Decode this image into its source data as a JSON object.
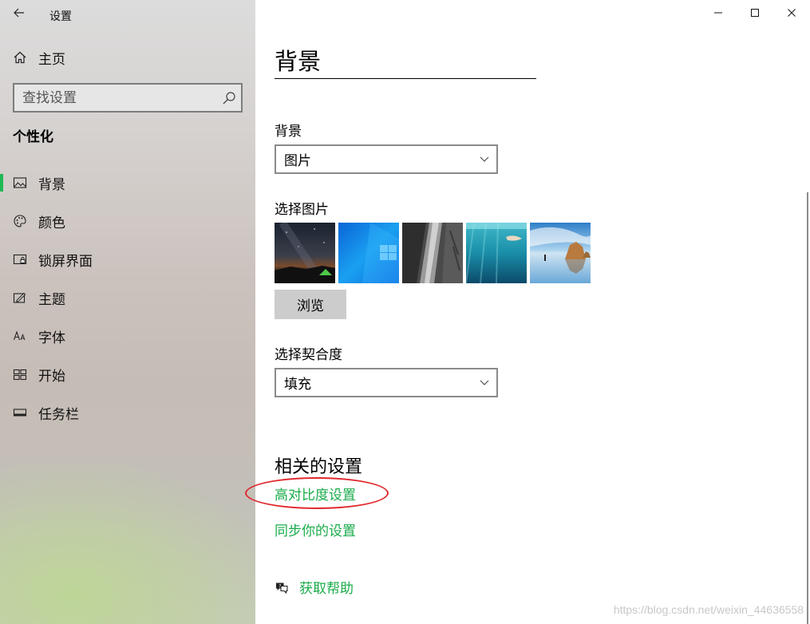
{
  "app": {
    "title": "设置"
  },
  "sidebar": {
    "home_label": "主页",
    "search_placeholder": "查找设置",
    "section_title": "个性化",
    "items": [
      {
        "label": "背景",
        "icon": "picture-icon",
        "active": true
      },
      {
        "label": "颜色",
        "icon": "palette-icon",
        "active": false
      },
      {
        "label": "锁屏界面",
        "icon": "lock-screen-icon",
        "active": false
      },
      {
        "label": "主题",
        "icon": "theme-icon",
        "active": false
      },
      {
        "label": "字体",
        "icon": "font-icon",
        "active": false
      },
      {
        "label": "开始",
        "icon": "start-icon",
        "active": false
      },
      {
        "label": "任务栏",
        "icon": "taskbar-icon",
        "active": false
      }
    ]
  },
  "main": {
    "title": "背景",
    "background_label": "背景",
    "background_value": "图片",
    "choose_picture_label": "选择图片",
    "browse_label": "浏览",
    "fit_label": "选择契合度",
    "fit_value": "填充",
    "related_title": "相关的设置",
    "links": [
      "高对比度设置",
      "同步你的设置"
    ],
    "help_label": "获取帮助"
  },
  "watermark": "https://blog.csdn.net/weixin_44636558",
  "colors": {
    "accent": "#1aab4a",
    "annotation": "#e0262b"
  }
}
